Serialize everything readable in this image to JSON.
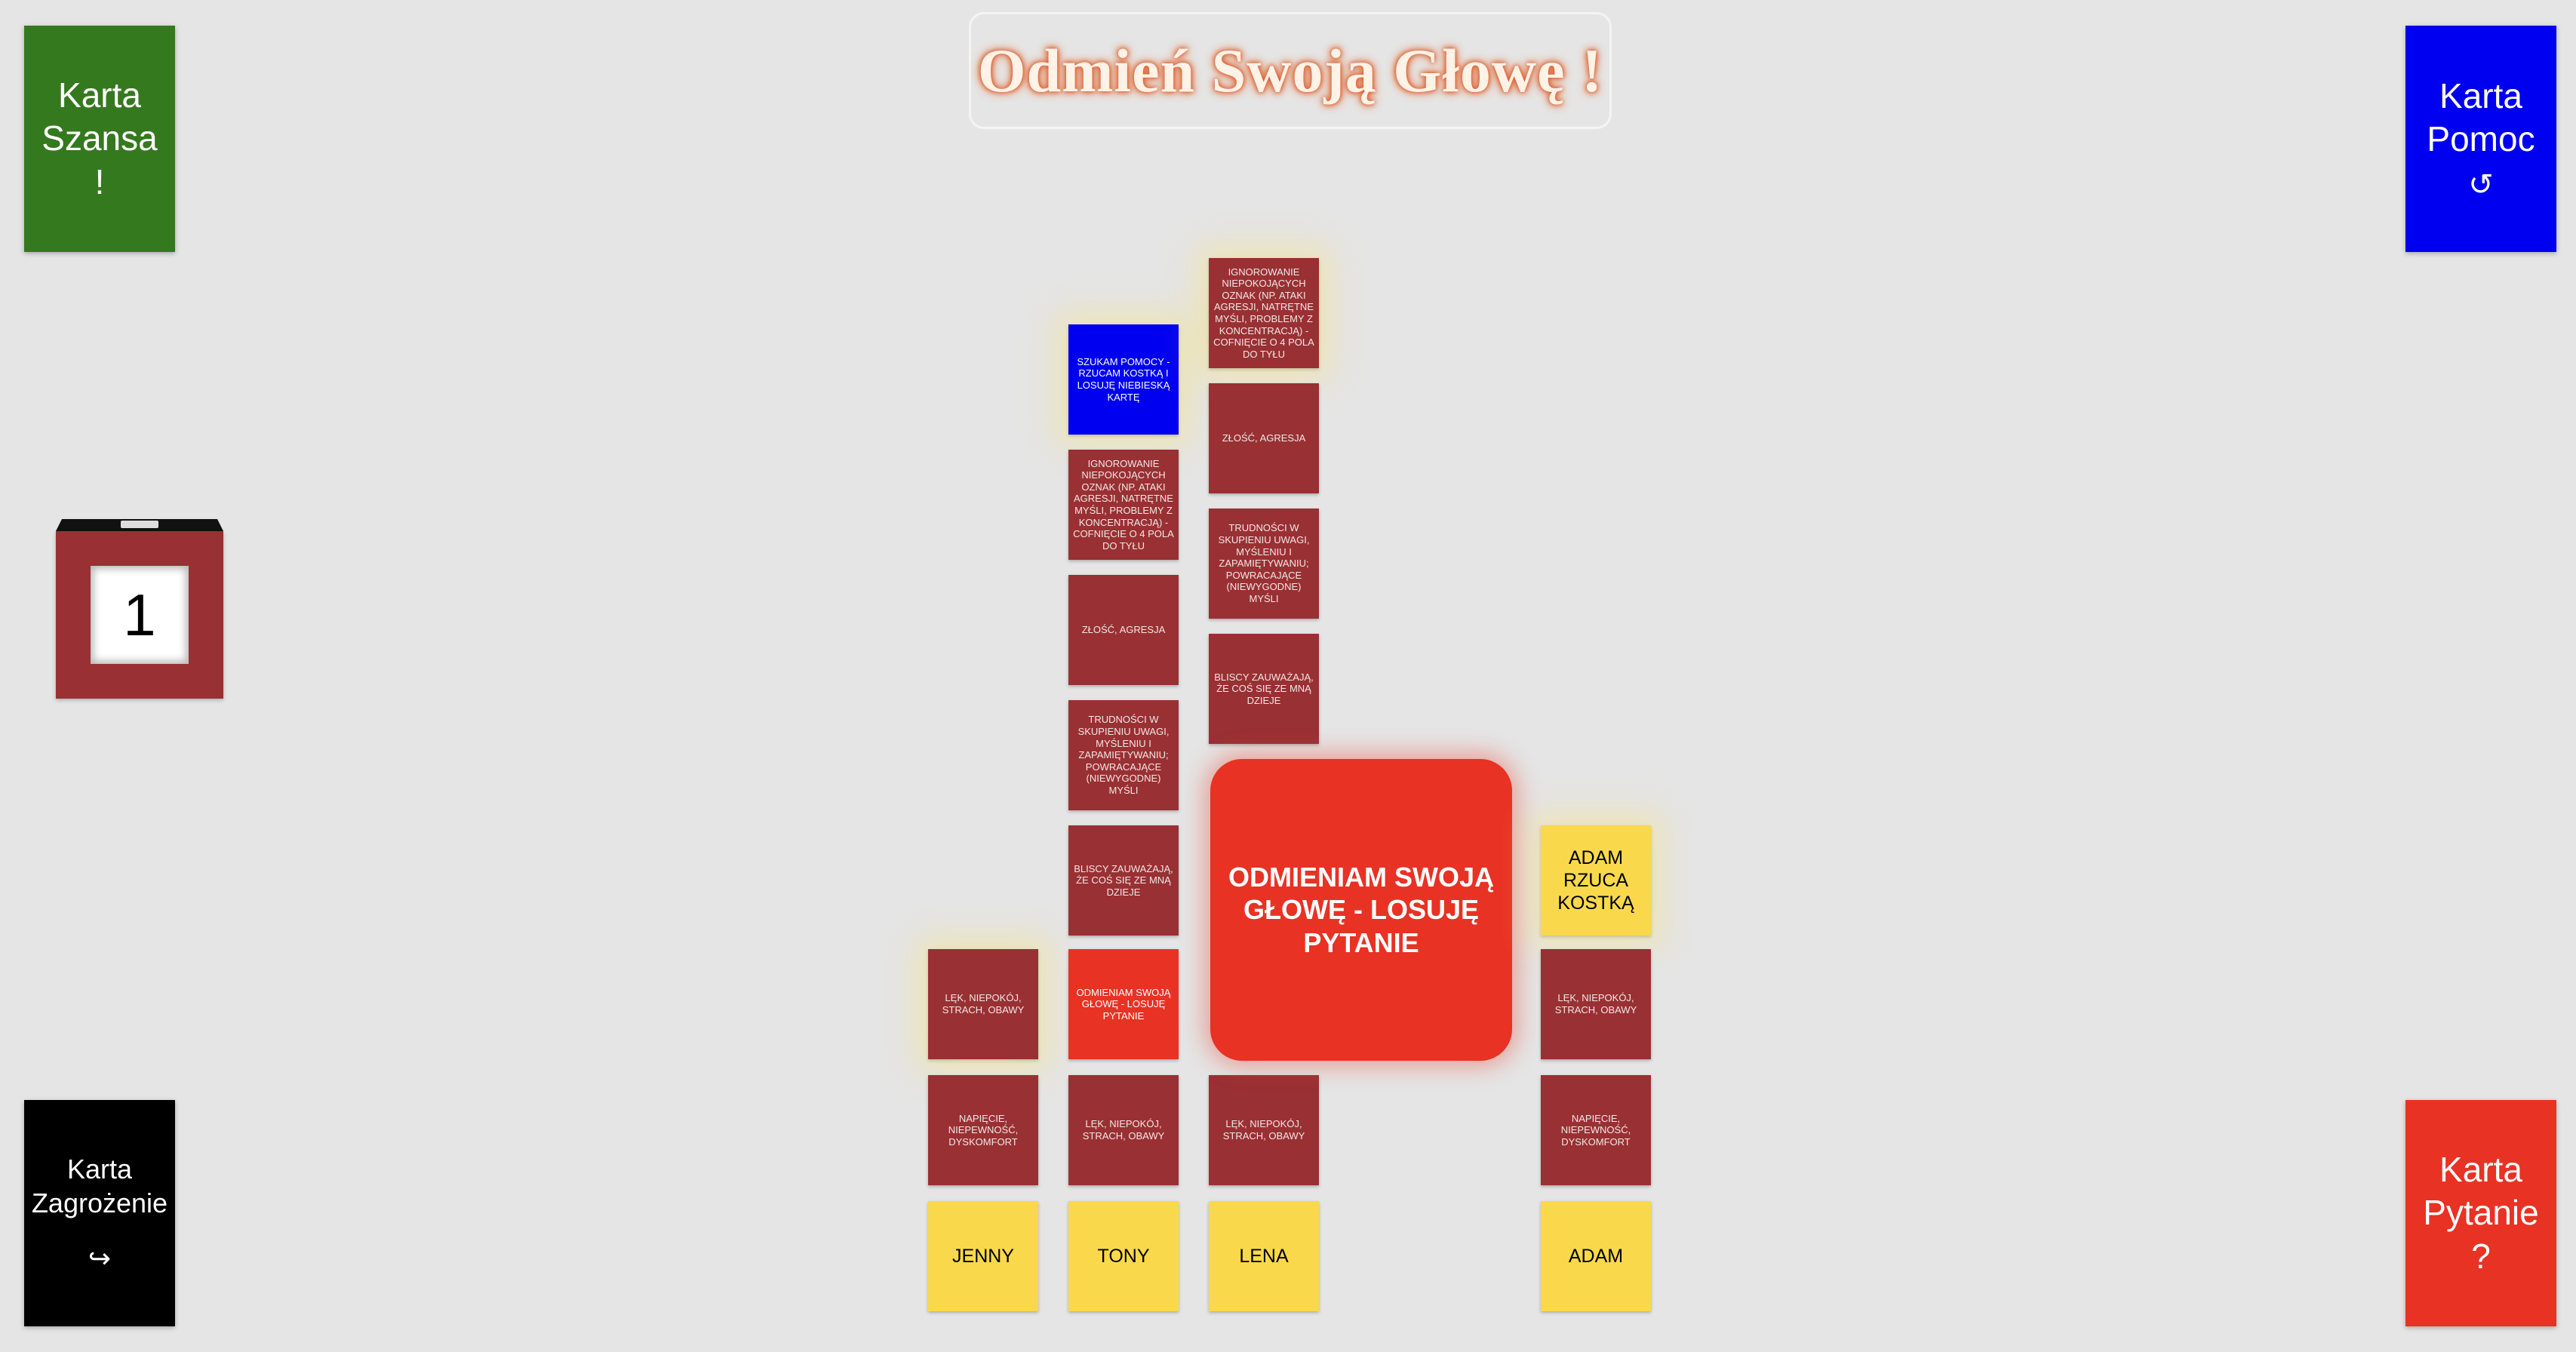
{
  "title": "Odmień Swoją Głowę !",
  "decks": {
    "szansa": {
      "line1": "Karta",
      "line2": "Szansa",
      "symbol": "!",
      "color": "#35791f"
    },
    "pomoc": {
      "line1": "Karta",
      "line2": "Pomoc",
      "symbol": "↺",
      "color": "#0000f0"
    },
    "zagrozenie": {
      "line1": "Karta",
      "line2": "Zagrożenie",
      "symbol": "↪",
      "color": "#000000"
    },
    "pytanie": {
      "line1": "Karta",
      "line2": "Pytanie",
      "symbol": "?",
      "color": "#e83224"
    }
  },
  "die": {
    "value": "1"
  },
  "center": {
    "text": "ODMIENIAM SWOJĄ GŁOWĘ - LOSUJĘ PYTANIE"
  },
  "tiles": {
    "ignorowanie": "IGNOROWANIE NIEPOKOJĄCYCH OZNAK (NP. ATAKI AGRESJI, NATRĘTNE MYŚLI, PROBLEMY Z KONCENTRACJĄ) - COFNIĘCIE O 4 POLA DO TYŁU",
    "zlosc": "ZŁOŚĆ, AGRESJA",
    "trudnosci": "TRUDNOŚCI W SKUPIENIU UWAGI, MYŚLENIU I ZAPAMIĘTYWANIU; POWRACAJĄCE (NIEWYGODNE) MYŚLI",
    "bliscy": "BLISCY ZAUWAŻAJĄ, ŻE COŚ SIĘ ZE MNĄ DZIEJE",
    "szukam": "SZUKAM POMOCY - RZUCAM KOSTKĄ I LOSUJĘ NIEBIESKĄ KARTĘ",
    "odmieniam": "ODMIENIAM SWOJĄ GŁOWĘ - LOSUJĘ PYTANIE",
    "lek": "LĘK, NIEPOKÓJ, STRACH, OBAWY",
    "napiecie": "NAPIĘCIE, NIEPEWNOŚĆ, DYSKOMFORT"
  },
  "status": {
    "roll": "ADAM RZUCA KOSTKĄ"
  },
  "players": [
    {
      "name": "JENNY"
    },
    {
      "name": "TONY"
    },
    {
      "name": "LENA"
    },
    {
      "name": "ADAM"
    }
  ]
}
